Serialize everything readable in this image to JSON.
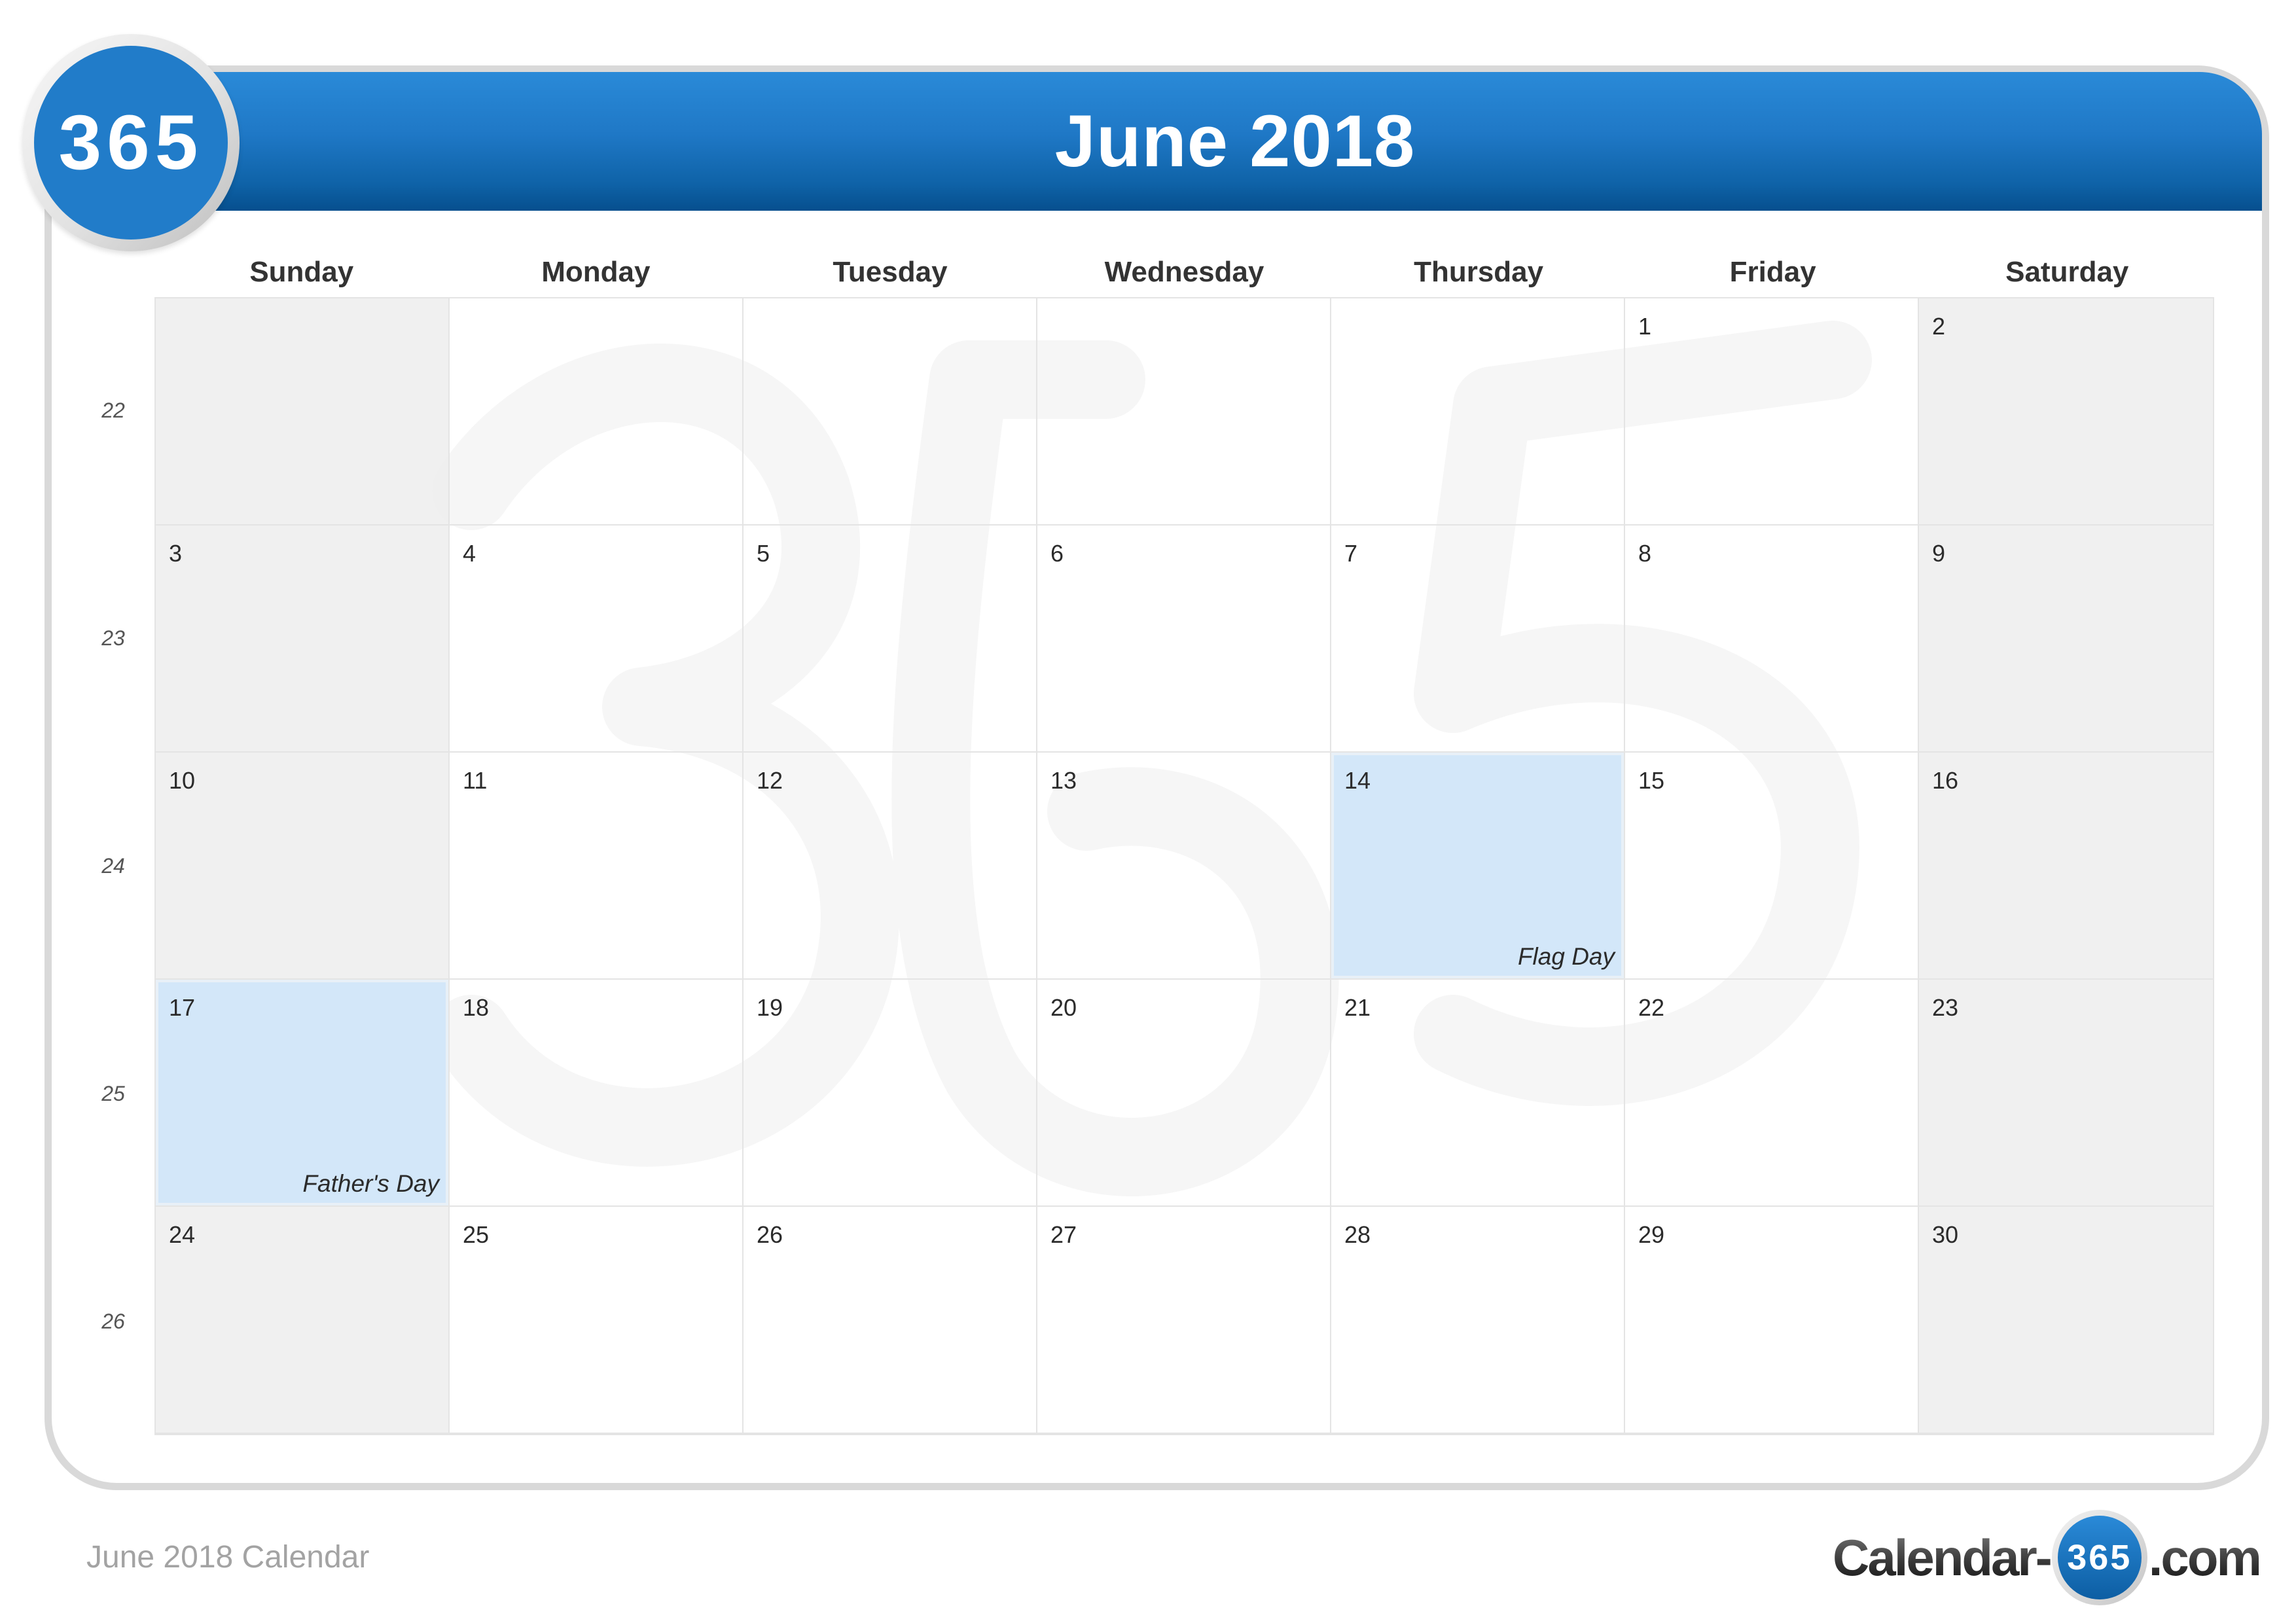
{
  "header": {
    "title": "June 2018",
    "logo_text": "365",
    "accent_color": "#217cc9"
  },
  "weekdays": [
    "Sunday",
    "Monday",
    "Tuesday",
    "Wednesday",
    "Thursday",
    "Friday",
    "Saturday"
  ],
  "week_numbers": [
    "22",
    "23",
    "24",
    "25",
    "26"
  ],
  "weeks": [
    [
      {
        "day": ""
      },
      {
        "day": ""
      },
      {
        "day": ""
      },
      {
        "day": ""
      },
      {
        "day": ""
      },
      {
        "day": "1"
      },
      {
        "day": "2"
      }
    ],
    [
      {
        "day": "3"
      },
      {
        "day": "4"
      },
      {
        "day": "5"
      },
      {
        "day": "6"
      },
      {
        "day": "7"
      },
      {
        "day": "8"
      },
      {
        "day": "9"
      }
    ],
    [
      {
        "day": "10"
      },
      {
        "day": "11"
      },
      {
        "day": "12"
      },
      {
        "day": "13"
      },
      {
        "day": "14",
        "event": "Flag Day"
      },
      {
        "day": "15"
      },
      {
        "day": "16"
      }
    ],
    [
      {
        "day": "17",
        "event": "Father's Day"
      },
      {
        "day": "18"
      },
      {
        "day": "19"
      },
      {
        "day": "20"
      },
      {
        "day": "21"
      },
      {
        "day": "22"
      },
      {
        "day": "23"
      }
    ],
    [
      {
        "day": "24"
      },
      {
        "day": "25"
      },
      {
        "day": "26"
      },
      {
        "day": "27"
      },
      {
        "day": "28"
      },
      {
        "day": "29"
      },
      {
        "day": "30"
      }
    ]
  ],
  "colors": {
    "holiday_fill": "#d3e7f9",
    "weekend_fill": "#efefef",
    "header_top": "#2a8ad8",
    "header_bottom": "#064f8e"
  },
  "footer": {
    "caption": "June 2018 Calendar",
    "brand_prefix": "Calendar-",
    "brand_badge": "365",
    "brand_suffix": ".com"
  }
}
